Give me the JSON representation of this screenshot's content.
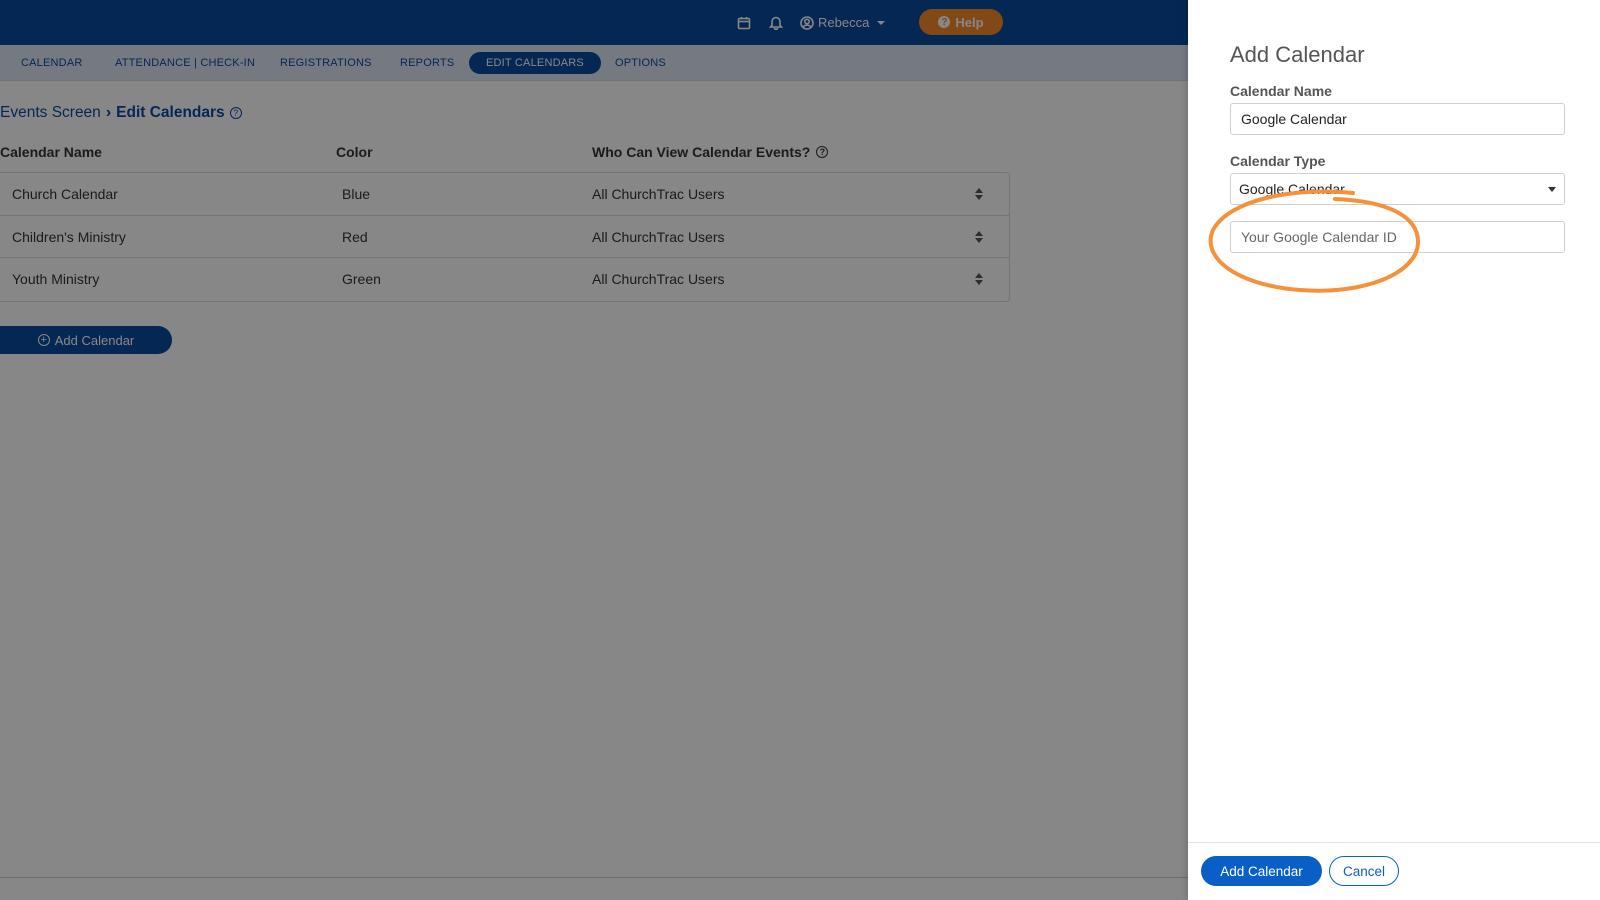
{
  "topbar": {
    "user_name": "Rebecca",
    "help_label": "Help",
    "brand_color": "#0a4a9f",
    "help_color": "#f58a2c"
  },
  "subnav": {
    "tabs": [
      {
        "label": "CALENDAR",
        "active": false
      },
      {
        "label": "ATTENDANCE | CHECK-IN",
        "active": false
      },
      {
        "label": "REGISTRATIONS",
        "active": false
      },
      {
        "label": "REPORTS",
        "active": false
      },
      {
        "label": "EDIT CALENDARS",
        "active": true
      },
      {
        "label": "OPTIONS",
        "active": false
      }
    ]
  },
  "breadcrumb": {
    "parent": "Events Screen",
    "current": "Edit Calendars"
  },
  "table": {
    "columns": [
      "Calendar Name",
      "Color",
      "Who Can View Calendar Events?"
    ],
    "rows": [
      {
        "name": "Church Calendar",
        "color": "Blue",
        "visibility": "All ChurchTrac Users"
      },
      {
        "name": "Children's Ministry",
        "color": "Red",
        "visibility": "All ChurchTrac Users"
      },
      {
        "name": "Youth Ministry",
        "color": "Green",
        "visibility": "All ChurchTrac Users"
      }
    ],
    "add_button_label": "Add Calendar"
  },
  "panel": {
    "title": "Add Calendar",
    "name_label": "Calendar Name",
    "name_value": "Google Calendar",
    "type_label": "Calendar Type",
    "type_value": "Google Calendar",
    "id_placeholder": "Your Google Calendar ID",
    "submit_label": "Add Calendar",
    "cancel_label": "Cancel",
    "annotation_color": "#f5913a"
  }
}
